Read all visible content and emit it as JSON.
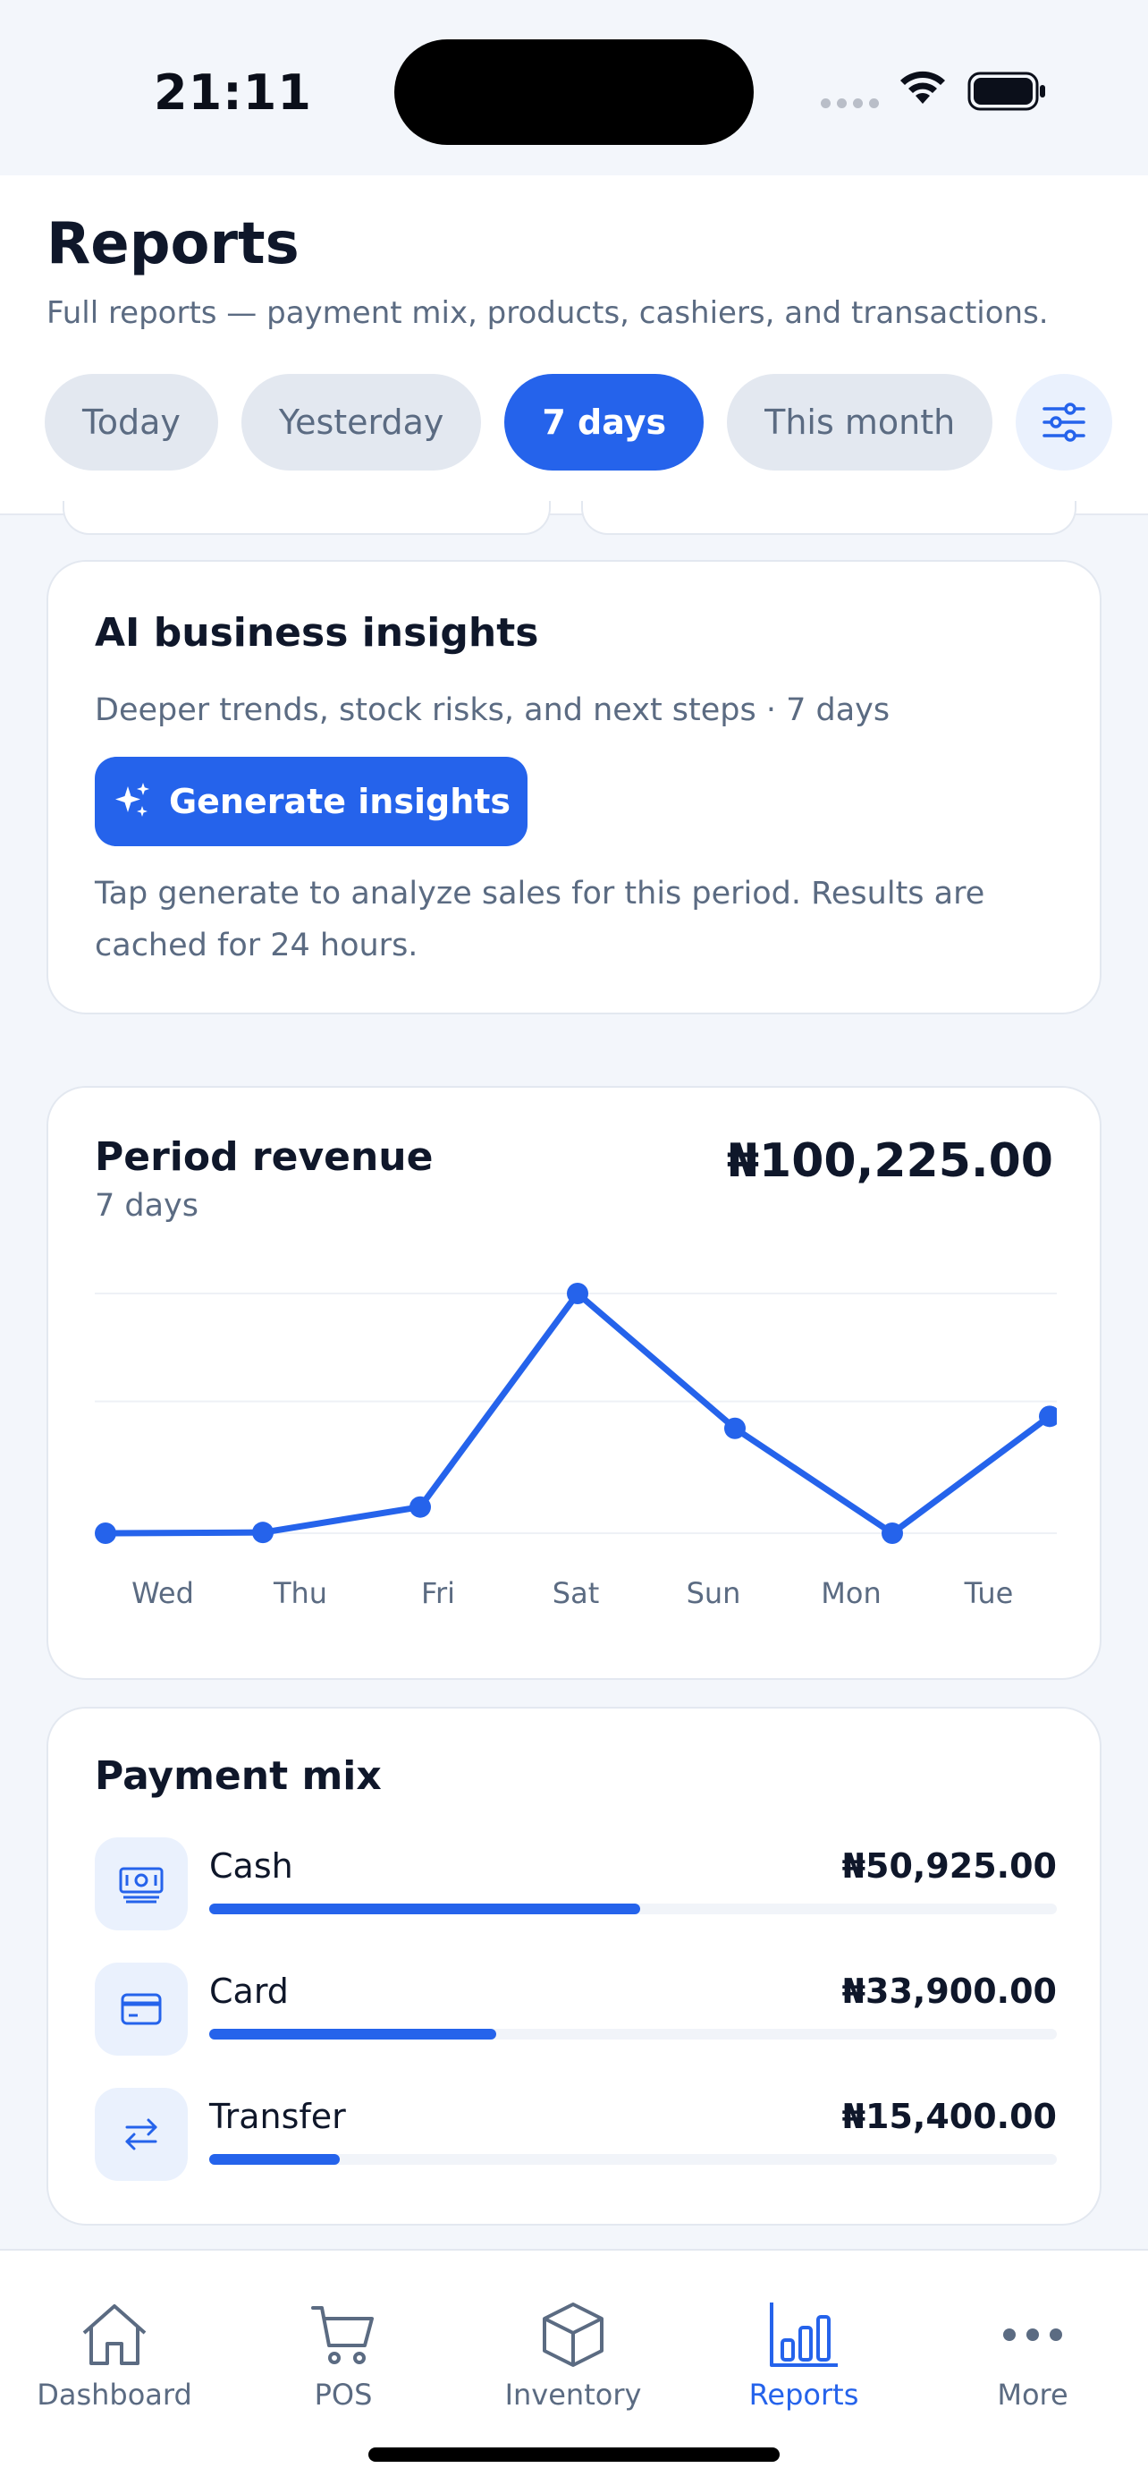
{
  "status_bar": {
    "time": "21:11"
  },
  "header": {
    "title": "Reports",
    "subtitle": "Full reports — payment mix, products, cashiers, and transactions.",
    "filters": [
      "Today",
      "Yesterday",
      "7 days",
      "This month"
    ],
    "active_filter": "7 days"
  },
  "ai_insights": {
    "title": "AI business insights",
    "subtitle": "Deeper trends, stock risks, and next steps · 7 days",
    "button_label": "Generate insights",
    "note": "Tap generate to analyze sales for this period. Results are cached for 24 hours."
  },
  "revenue": {
    "title": "Period revenue",
    "period": "7 days",
    "total": "₦100,225.00"
  },
  "chart_data": {
    "type": "line",
    "categories": [
      "Wed",
      "Thu",
      "Fri",
      "Sat",
      "Sun",
      "Mon",
      "Tue"
    ],
    "series": [
      {
        "values": [
          0,
          100,
          3500,
          32000,
          14000,
          0,
          15600
        ]
      }
    ],
    "ylim": [
      0,
      32000
    ],
    "grid": true,
    "color": "#2563eb"
  },
  "payment_mix": {
    "title": "Payment mix",
    "items": [
      {
        "label": "Cash",
        "amount": "₦50,925.00",
        "value": 50925,
        "icon": "cash-icon"
      },
      {
        "label": "Card",
        "amount": "₦33,900.00",
        "value": 33900,
        "icon": "card-icon"
      },
      {
        "label": "Transfer",
        "amount": "₦15,400.00",
        "value": 15400,
        "icon": "transfer-icon"
      }
    ],
    "scale_max": 100225
  },
  "tabbar": {
    "tabs": [
      {
        "label": "Dashboard",
        "icon": "home-icon"
      },
      {
        "label": "POS",
        "icon": "cart-icon"
      },
      {
        "label": "Inventory",
        "icon": "box-icon"
      },
      {
        "label": "Reports",
        "icon": "bar-chart-icon"
      },
      {
        "label": "More",
        "icon": "more-icon"
      }
    ],
    "active": "Reports"
  }
}
